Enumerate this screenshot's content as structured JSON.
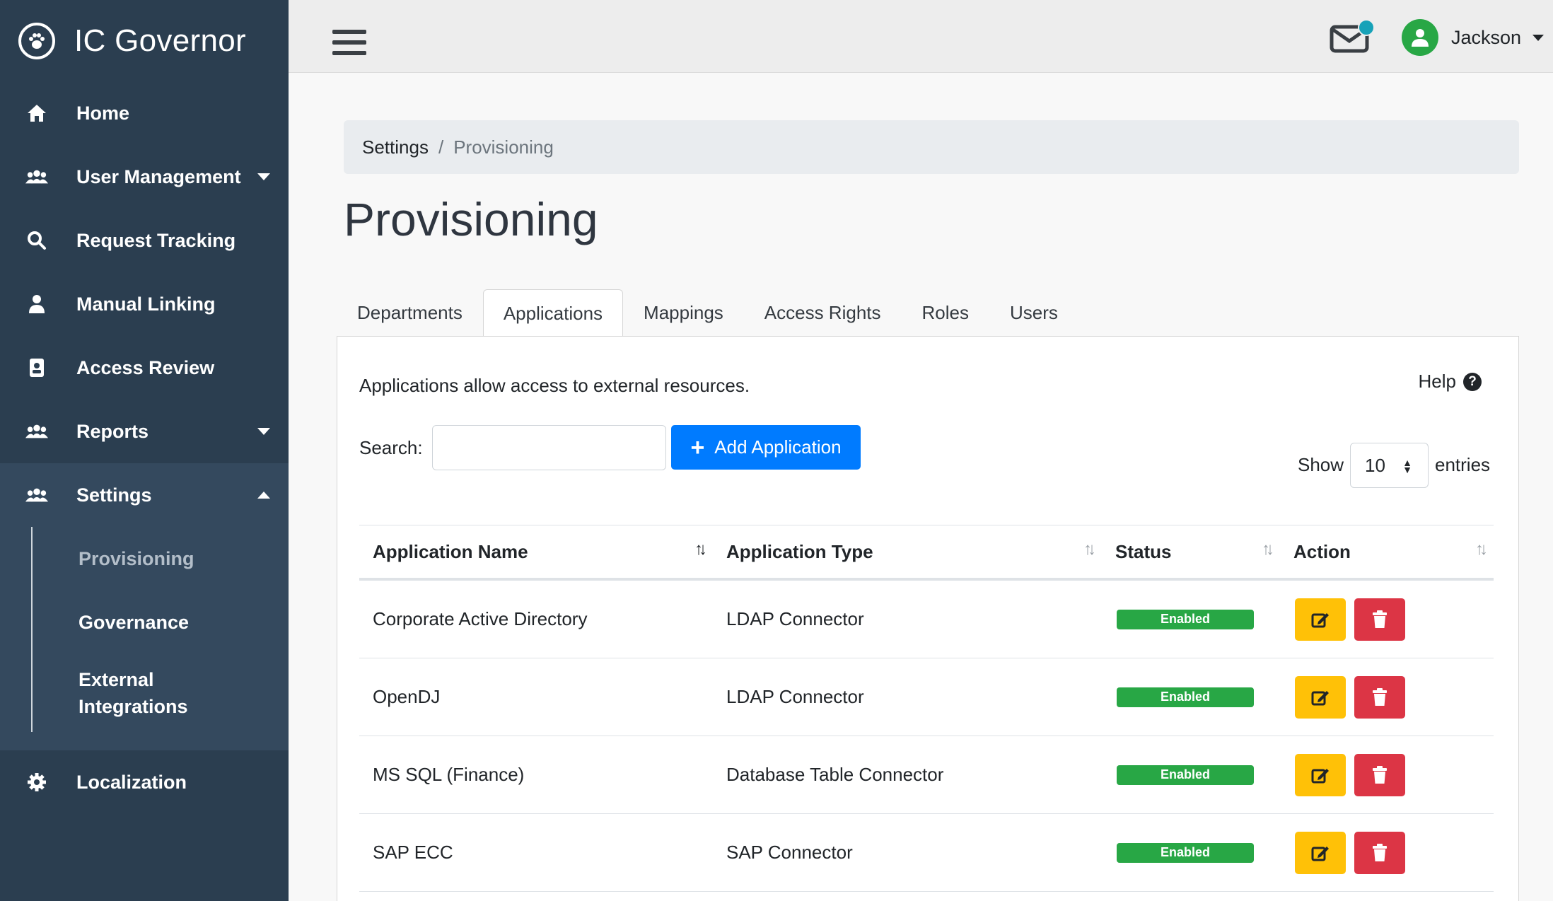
{
  "app": {
    "brand": "IC Governor"
  },
  "colors": {
    "sidebar": "#2b3e50",
    "primary": "#007bff",
    "success": "#28a745",
    "warning": "#ffc107",
    "danger": "#dc3545"
  },
  "sidebar": {
    "items": [
      {
        "label": "Home",
        "icon": "home-icon"
      },
      {
        "label": "User Management",
        "icon": "users-icon"
      },
      {
        "label": "Request Tracking",
        "icon": "search-icon"
      },
      {
        "label": "Manual Linking",
        "icon": "user-icon"
      },
      {
        "label": "Access Review",
        "icon": "id-badge-icon"
      },
      {
        "label": "Reports",
        "icon": "users-icon"
      },
      {
        "label": "Settings",
        "icon": "users-icon"
      },
      {
        "label": "Localization",
        "icon": "gear-icon"
      }
    ],
    "settings_sub": [
      {
        "label": "Provisioning"
      },
      {
        "label": "Governance"
      },
      {
        "label": "External Integrations"
      }
    ]
  },
  "topbar": {
    "user_name": "Jackson"
  },
  "breadcrumb": {
    "parent": "Settings",
    "sep": "/",
    "current": "Provisioning"
  },
  "page": {
    "title": "Provisioning"
  },
  "tabs": [
    "Departments",
    "Applications",
    "Mappings",
    "Access Rights",
    "Roles",
    "Users"
  ],
  "panel": {
    "description": "Applications allow access to external resources.",
    "help": "Help",
    "search_label": "Search:",
    "search_value": "",
    "add_button": "Add Application",
    "show_label": "Show",
    "entries_value": "10",
    "entries_label": "entries"
  },
  "table": {
    "columns": [
      "Application Name",
      "Application Type",
      "Status",
      "Action"
    ],
    "rows": [
      {
        "name": "Corporate Active Directory",
        "type": "LDAP Connector",
        "status": "Enabled"
      },
      {
        "name": "OpenDJ",
        "type": "LDAP Connector",
        "status": "Enabled"
      },
      {
        "name": "MS SQL (Finance)",
        "type": "Database Table Connector",
        "status": "Enabled"
      },
      {
        "name": "SAP ECC",
        "type": "SAP Connector",
        "status": "Enabled"
      }
    ]
  }
}
